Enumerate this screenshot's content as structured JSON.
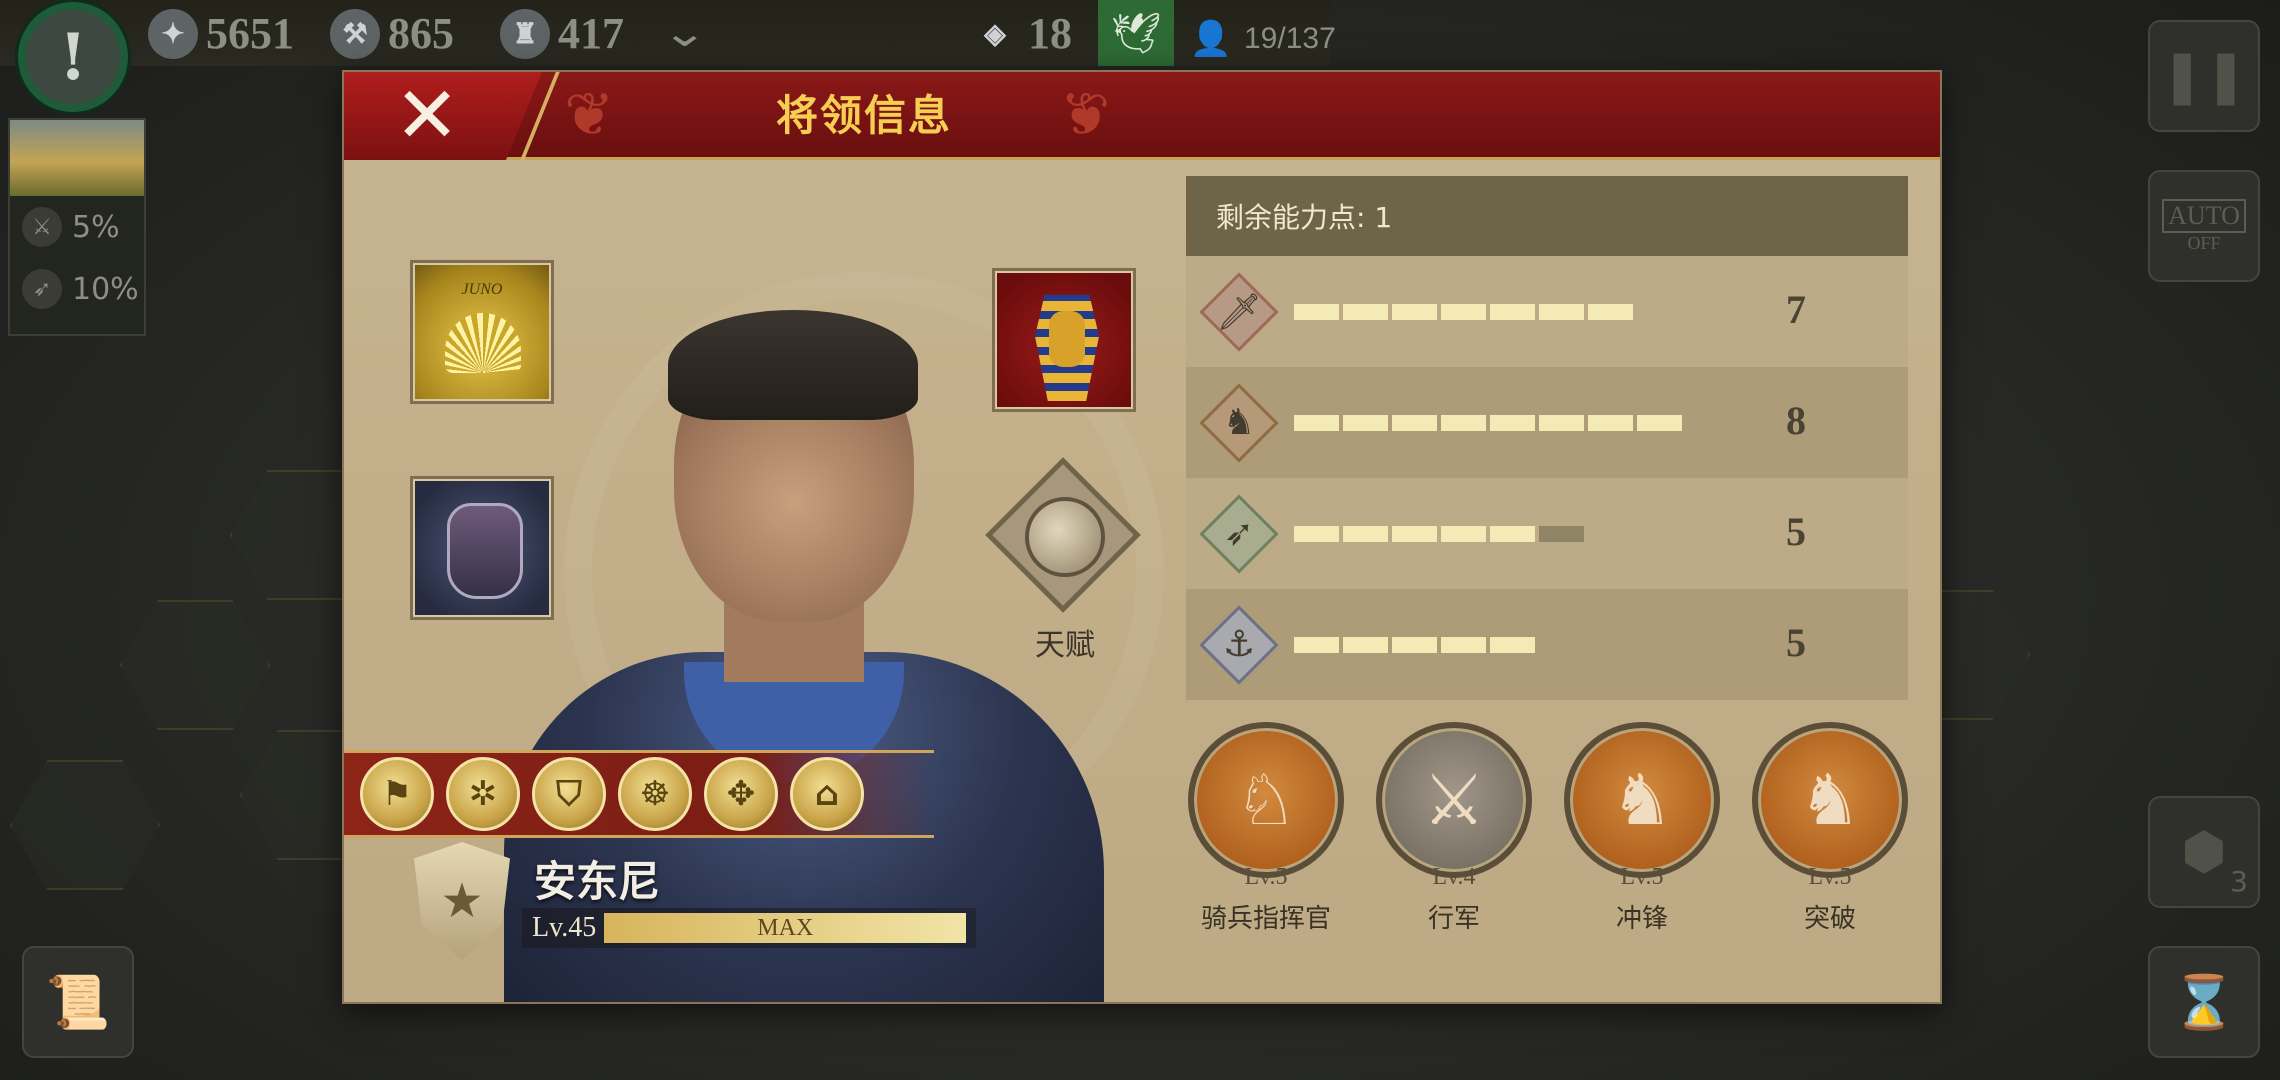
{
  "hud": {
    "gold": "5651",
    "hammers": "865",
    "manpower": "417",
    "tokens": "18",
    "population": "19/137"
  },
  "left_panel": {
    "stats": [
      "5%",
      "10%"
    ]
  },
  "side_buttons": {
    "auto_top": "AUTO",
    "auto_bottom": "OFF",
    "hex_count": "3"
  },
  "dialog": {
    "title": "将领信息",
    "banner_text": "JUNO",
    "talent_label": "天赋",
    "general": {
      "name": "安东尼",
      "level": "Lv.45",
      "exp_label": "MAX",
      "skill_icons": [
        "skill-1",
        "skill-2",
        "skill-3",
        "skill-4",
        "skill-5",
        "skill-6"
      ]
    },
    "points_label": "剩余能力点: 1",
    "attributes": [
      {
        "icon": "sword-icon",
        "value": "7",
        "segments": 7,
        "dim": 0
      },
      {
        "icon": "horse-icon",
        "value": "8",
        "segments": 8,
        "dim": 0
      },
      {
        "icon": "bow-icon",
        "value": "5",
        "segments": 5,
        "dim": 1
      },
      {
        "icon": "anchor-icon",
        "value": "5",
        "segments": 5,
        "dim": 0
      }
    ],
    "skills": [
      {
        "level": "Lv.5",
        "name": "骑兵指挥官",
        "icon": "horse-head-icon"
      },
      {
        "level": "Lv.4",
        "name": "行军",
        "icon": "marching-troops-icon"
      },
      {
        "level": "Lv.5",
        "name": "冲锋",
        "icon": "charging-rider-icon"
      },
      {
        "level": "Lv.5",
        "name": "突破",
        "icon": "breakthrough-icon"
      }
    ]
  },
  "colors": {
    "header_red": "#8b1818",
    "title_gold": "#f6cf52",
    "panel_tan": "#c5b28c"
  }
}
